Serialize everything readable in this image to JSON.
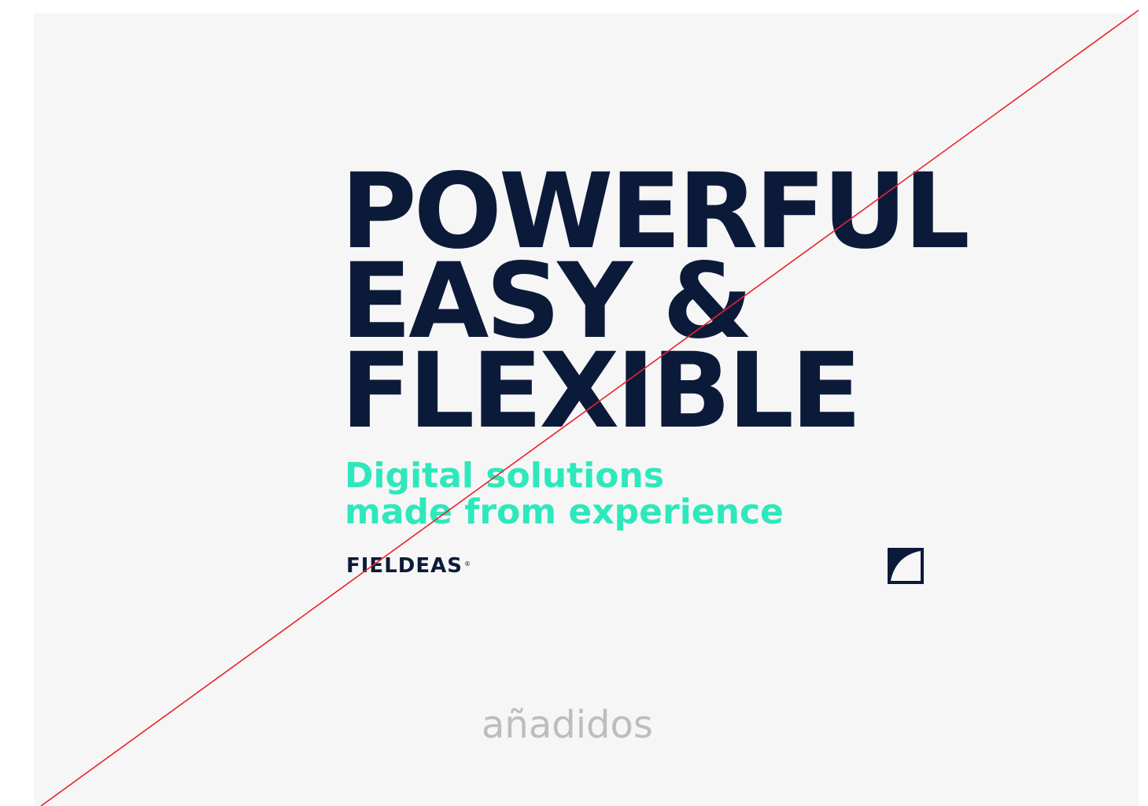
{
  "headline": {
    "line1": "POWERFUL",
    "line2": "EASY &",
    "line3": "FLEXIBLE"
  },
  "tagline": {
    "line1": "Digital solutions",
    "line2": "made from experience"
  },
  "brand": {
    "name": "FIELDEAS",
    "registered": "®"
  },
  "caption": "añadidos",
  "colors": {
    "background": "#f6f6f6",
    "navy": "#0c1a3a",
    "accent": "#2ee8bd",
    "caption": "#bdbdbd",
    "strike_line": "#e8242c"
  },
  "icons": {
    "brand_mark": "fieldeas-square-logo-icon"
  }
}
